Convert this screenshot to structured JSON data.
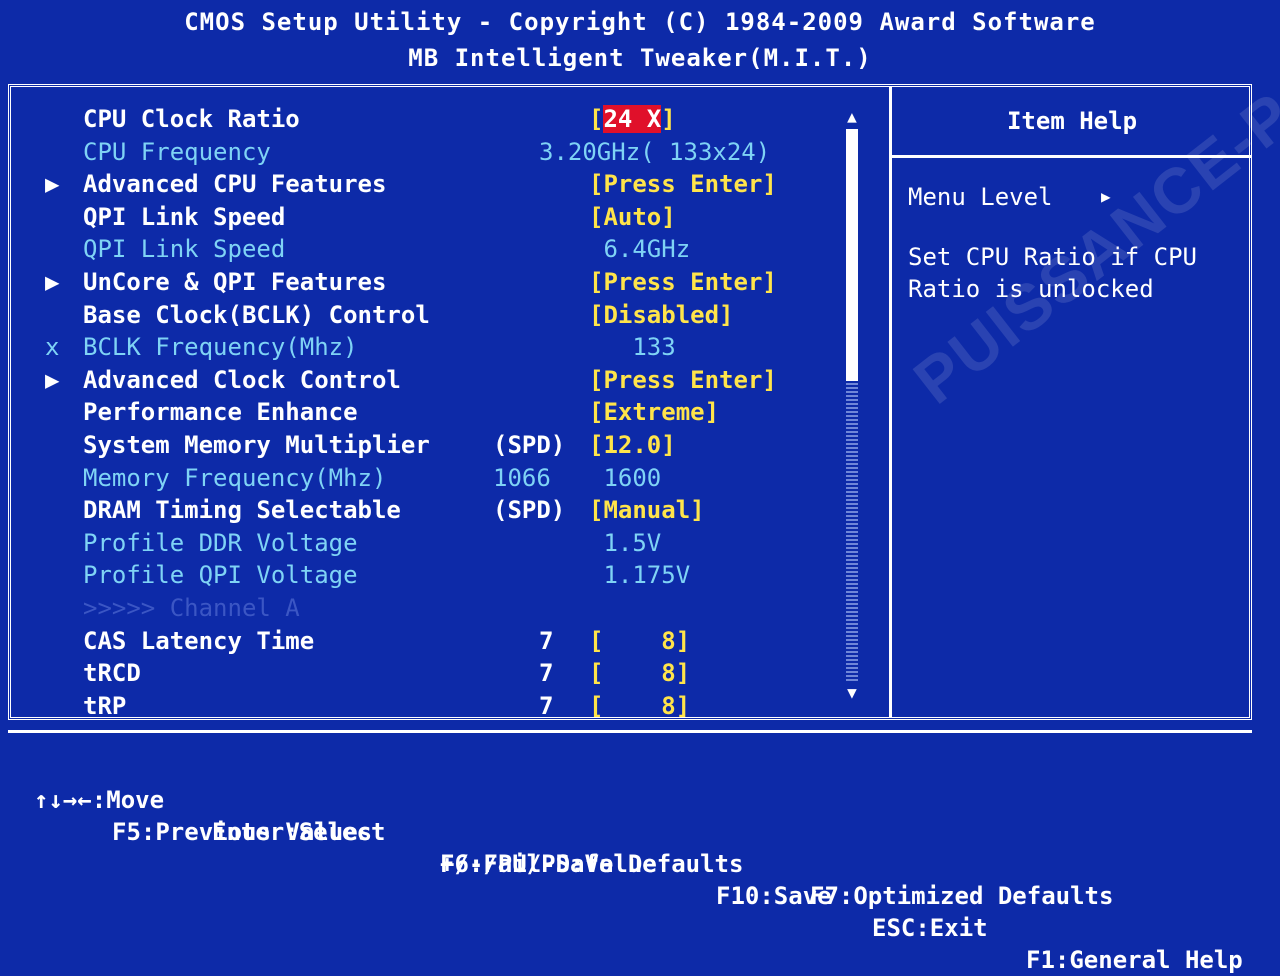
{
  "header": {
    "title": "CMOS Setup Utility - Copyright (C) 1984-2009 Award Software",
    "subtitle": "MB Intelligent Tweaker(M.I.T.)"
  },
  "rows": [
    {
      "marker": "",
      "label": "CPU Clock Ratio",
      "mid": "",
      "value": "[24 X]",
      "style": "normal",
      "selected": true
    },
    {
      "marker": "",
      "label": "CPU Frequency",
      "mid": "3.20GHz( 133x24)",
      "value": "",
      "style": "dim"
    },
    {
      "marker": "▶",
      "label": "Advanced CPU Features",
      "mid": "",
      "value": "[Press Enter]",
      "style": "normal"
    },
    {
      "marker": "",
      "label": "QPI Link Speed",
      "mid": "",
      "value": "[Auto]",
      "style": "normal"
    },
    {
      "marker": "",
      "label": "QPI Link Speed",
      "mid": "",
      "value": " 6.4GHz",
      "style": "dim"
    },
    {
      "marker": "▶",
      "label": "UnCore & QPI Features",
      "mid": "",
      "value": "[Press Enter]",
      "style": "normal"
    },
    {
      "marker": "",
      "label": "Base Clock(BCLK) Control",
      "mid": "",
      "value": "[Disabled]",
      "style": "normal"
    },
    {
      "marker": "x",
      "label": "BCLK Frequency(Mhz)",
      "mid": "",
      "value": "   133",
      "style": "dim"
    },
    {
      "marker": "▶",
      "label": "Advanced Clock Control",
      "mid": "",
      "value": "[Press Enter]",
      "style": "normal"
    },
    {
      "marker": "",
      "label": "Performance Enhance",
      "mid": "",
      "value": "[Extreme]",
      "style": "normal"
    },
    {
      "marker": "",
      "label": "System Memory Multiplier",
      "mid": "(SPD)",
      "value": "[12.0]",
      "style": "normal"
    },
    {
      "marker": "",
      "label": "Memory Frequency(Mhz)",
      "mid": "1066",
      "value": " 1600",
      "style": "dim"
    },
    {
      "marker": "",
      "label": "DRAM Timing Selectable",
      "mid": "(SPD)",
      "value": "[Manual]",
      "style": "normal"
    },
    {
      "marker": "",
      "label": "Profile DDR Voltage",
      "mid": "",
      "value": " 1.5V",
      "style": "dim"
    },
    {
      "marker": "",
      "label": "Profile QPI Voltage",
      "mid": "",
      "value": " 1.175V",
      "style": "dim"
    },
    {
      "marker": "",
      "label": ">>>>> Channel A",
      "mid": "",
      "value": "",
      "style": "dark"
    },
    {
      "marker": "",
      "label": "CAS Latency Time",
      "mid": "7",
      "value": "[    8]",
      "style": "normal"
    },
    {
      "marker": "",
      "label": "tRCD",
      "mid": "7",
      "value": "[    8]",
      "style": "normal"
    },
    {
      "marker": "",
      "label": "tRP",
      "mid": "7",
      "value": "[    8]",
      "style": "normal"
    }
  ],
  "help": {
    "title": "Item Help",
    "menu_level": "Menu Level",
    "text_line1": "Set CPU Ratio if CPU",
    "text_line2": "Ratio is unlocked"
  },
  "watermark": "PUISSANCE-PC",
  "footer": {
    "move": "↑↓→←:Move",
    "select": "Enter:Select",
    "value": "+/-/PU/PD:Value",
    "save": "F10:Save",
    "exit": "ESC:Exit",
    "general_help": "F1:General Help",
    "previous": "F5:Previous Values",
    "failsafe": "F6:Fail-Safe Defaults",
    "optimized": "F7:Optimized Defaults"
  },
  "colors": {
    "background": "#0d2aa8",
    "value": "#ffe44a",
    "dim": "#7fd3f5",
    "selection": "#e0102a"
  }
}
